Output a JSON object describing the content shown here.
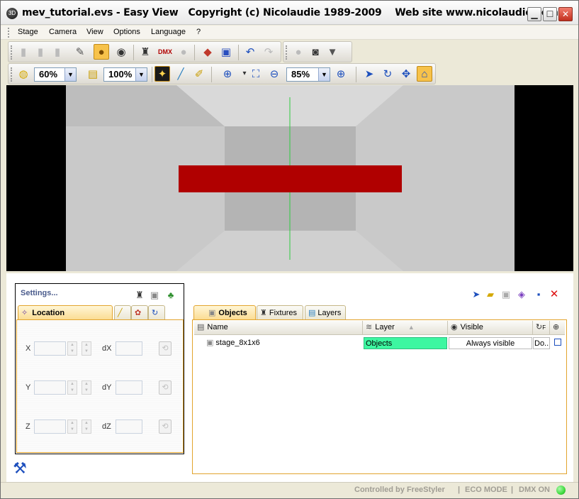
{
  "window": {
    "title": "mev_tutorial.evs - Easy View   Copyright (c) Nicolaudie 1989-2009    Web site www.nicolaudie.com",
    "icon_label": "3D",
    "controls": {
      "minimize": "▁",
      "maximize": "☐",
      "close": "✕"
    }
  },
  "menu": {
    "items": [
      {
        "label": "Stage"
      },
      {
        "label": "Camera"
      },
      {
        "label": "View"
      },
      {
        "label": "Options"
      },
      {
        "label": "Language"
      },
      {
        "label": "?"
      }
    ]
  },
  "toolbar": {
    "brightness_value": "60%",
    "scale_value": "100%",
    "zoom_value": "85%"
  },
  "settings": {
    "title": "Settings...",
    "tabs": [
      {
        "label": "Location"
      }
    ],
    "fields": {
      "x": "X",
      "y": "Y",
      "z": "Z",
      "dx": "dX",
      "dy": "dY",
      "dz": "dZ"
    }
  },
  "objects_panel": {
    "tabs": [
      {
        "label": "Objects"
      },
      {
        "label": "Fixtures"
      },
      {
        "label": "Layers"
      }
    ],
    "columns": [
      {
        "label": "Name"
      },
      {
        "label": "Layer"
      },
      {
        "label": "Visible"
      },
      {
        "label": "F"
      }
    ],
    "rows": [
      {
        "name": "stage_8x1x6",
        "layer": "Objects",
        "visible": "Always visible",
        "extra": "Do..."
      }
    ],
    "colors": {
      "layer_cell": "#3df7a1"
    }
  },
  "status": {
    "controlled_by": "Controlled by FreeStyler",
    "eco_mode": "ECO MODE",
    "dmx": "DMX ON",
    "separator": "|",
    "dmx_led_color": "#3fdc3f"
  },
  "icons": [
    "new-icon",
    "open-icon",
    "save-icon",
    "wrench-icon",
    "zoom-icon",
    "eye-icon",
    "fixture-icon",
    "dmx-icon",
    "sphere-icon",
    "color-icon",
    "cube-icon",
    "undo-icon",
    "redo-icon",
    "camera-icon",
    "render-icon",
    "bulb-icon",
    "scale-icon",
    "light-beam-icon",
    "pencil-icon",
    "zoom-in-icon",
    "fit-icon",
    "minus-icon",
    "plus-icon",
    "pointer-icon",
    "rotate-icon",
    "move-icon",
    "home-icon"
  ],
  "colors": {
    "stage_bar": "#b00000",
    "axis_line": "#2ecc40",
    "accent": "#e2a42d"
  }
}
